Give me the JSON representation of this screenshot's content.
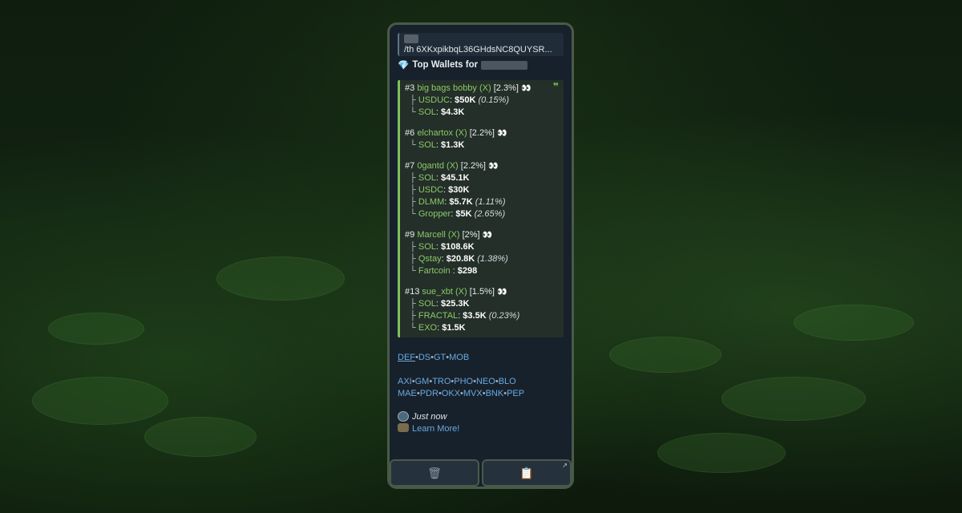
{
  "reply": {
    "text": "/th 6XKxpikbqL36GHdsNC8QUYSR..."
  },
  "header": {
    "icon": "💎",
    "title": "Top Wallets for"
  },
  "wallets": [
    {
      "rank": "#3",
      "name": "big bags bobby",
      "x": "(X)",
      "share": "[2.3%]",
      "eyes": "👀",
      "items": [
        {
          "tree": "├",
          "token": "USDUC",
          "value": "$50K",
          "pct": "(0.15%)"
        },
        {
          "tree": "└",
          "token": "SOL",
          "value": "$4.3K",
          "pct": ""
        }
      ]
    },
    {
      "rank": "#6",
      "name": "elchartox",
      "x": "(X)",
      "share": "[2.2%]",
      "eyes": "👀",
      "items": [
        {
          "tree": "└",
          "token": "SOL",
          "value": "$1.3K",
          "pct": ""
        }
      ]
    },
    {
      "rank": "#7",
      "name": "0gantd",
      "x": "(X)",
      "share": "[2.2%]",
      "eyes": "👀",
      "items": [
        {
          "tree": "├",
          "token": "SOL",
          "value": "$45.1K",
          "pct": ""
        },
        {
          "tree": "├",
          "token": "USDC",
          "value": "$30K",
          "pct": ""
        },
        {
          "tree": "├",
          "token": "DLMM",
          "value": "$5.7K",
          "pct": "(1.11%)"
        },
        {
          "tree": "└",
          "token": "Gropper",
          "value": "$5K",
          "pct": "(2.65%)"
        }
      ]
    },
    {
      "rank": "#9",
      "name": "Marcell",
      "x": "(X)",
      "share": "[2%]",
      "eyes": "👀",
      "items": [
        {
          "tree": "├",
          "token": "SOL",
          "value": "$108.6K",
          "pct": ""
        },
        {
          "tree": "├",
          "token": "Qstay",
          "value": "$20.8K",
          "pct": "(1.38%)"
        },
        {
          "tree": "└",
          "token": "Fartcoin ",
          "value": "$298",
          "pct": ""
        }
      ]
    },
    {
      "rank": "#13",
      "name": "sue_xbt",
      "x": "(X)",
      "share": "[1.5%]",
      "eyes": "👀",
      "items": [
        {
          "tree": "├",
          "token": "SOL",
          "value": "$25.3K",
          "pct": ""
        },
        {
          "tree": "├",
          "token": "FRACTAL",
          "value": "$3.5K",
          "pct": "(0.23%)"
        },
        {
          "tree": "└",
          "token": "EXO",
          "value": "$1.5K",
          "pct": ""
        }
      ]
    }
  ],
  "link_rows": [
    [
      "DEF",
      "DS",
      "GT",
      "MOB"
    ],
    [],
    [
      "AXI",
      "GM",
      "TRO",
      "PHO",
      "NEO",
      "BLO"
    ],
    [
      "MAE",
      "PDR",
      "OKX",
      "MVX",
      "BNK",
      "PEP"
    ]
  ],
  "link_separator": "•",
  "footer": {
    "timestamp": "Just now",
    "learn_more": "Learn More!"
  },
  "buttons": [
    {
      "icon": "trash-icon",
      "glyph": "🗑"
    },
    {
      "icon": "clipboard-icon",
      "glyph": "📋",
      "corner": "↗"
    }
  ]
}
